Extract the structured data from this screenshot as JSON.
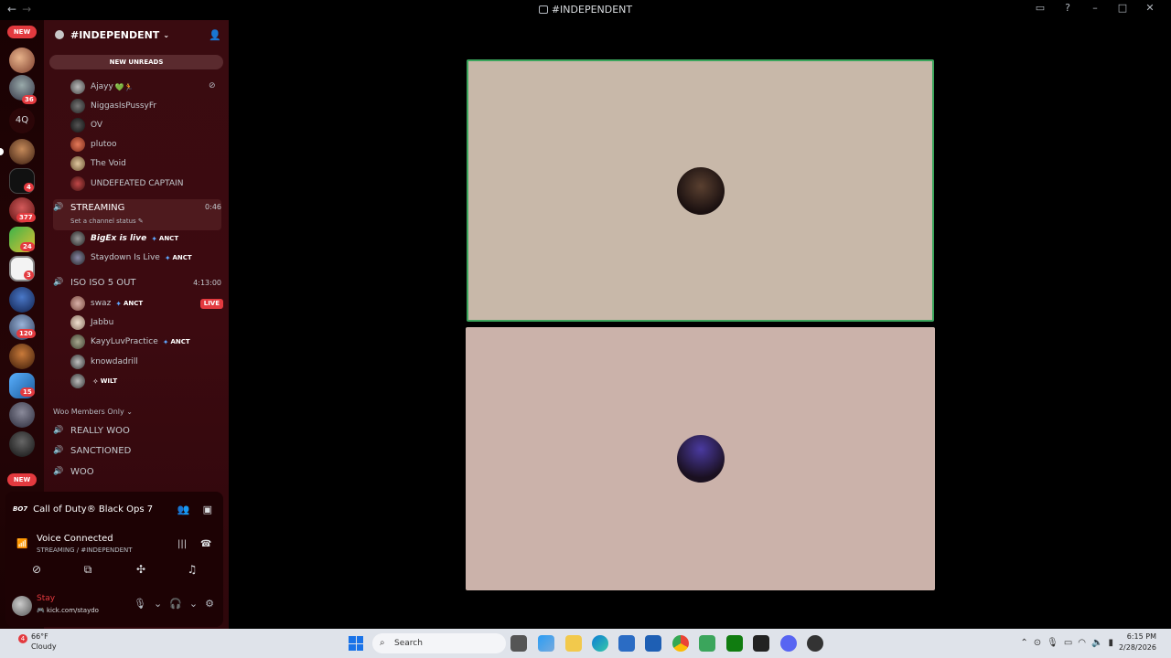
{
  "window": {
    "title": "#INDEPENDENT"
  },
  "server": {
    "name": "#INDEPENDENT",
    "new_unreads": "NEW UNREADS"
  },
  "guild_rail": {
    "new_top": "NEW",
    "badge_36": "36",
    "label_4q": "4Q",
    "badge_4": "4",
    "badge_377": "377",
    "badge_24": "24",
    "badge_3": "3",
    "badge_120": "120",
    "badge_15": "15",
    "new_bottom": "NEW"
  },
  "members_top": [
    {
      "name": "Ajayy",
      "emoji": "💚🏃"
    },
    {
      "name": "NiggasIsPussyFr"
    },
    {
      "name": "OV"
    },
    {
      "name": "plutoo"
    },
    {
      "name": "The Void"
    },
    {
      "name": "UNDEFEATED CAPTAIN"
    }
  ],
  "streaming_channel": {
    "name": "STREAMING",
    "time": "0:46",
    "status_placeholder": "Set a channel status",
    "members": [
      {
        "name": "BigEx is live",
        "tag": "ANCT"
      },
      {
        "name": "Staydown Is Live",
        "tag": "ANCT"
      }
    ]
  },
  "iso_channel": {
    "name": "ISO ISO 5 OUT",
    "time": "4:13:00",
    "live": "LIVE",
    "members": [
      {
        "name": "swaz",
        "tag": "ANCT"
      },
      {
        "name": "Jabbu"
      },
      {
        "name": "KayyLuvPractice",
        "tag": "ANCT"
      },
      {
        "name": "knowdadrill"
      },
      {
        "name": "",
        "tag": "WILT"
      }
    ]
  },
  "category": {
    "name": "Woo Members Only",
    "channels": [
      "REALLY WOO",
      "SANCTIONED",
      "WOO"
    ]
  },
  "game_activity": {
    "logo": "BO7",
    "name": "Call of Duty® Black Ops 7"
  },
  "voice": {
    "status": "Voice Connected",
    "location": "STREAMING / #INDEPENDENT"
  },
  "user": {
    "name": "Stay",
    "status": "kick.com/staydo"
  },
  "taskbar": {
    "temp": "66°F",
    "condition": "Cloudy",
    "weather_badge": "4",
    "search_placeholder": "Search",
    "time": "6:15 PM",
    "date": "2/28/2026"
  },
  "colors": {
    "accent_red": "#e33a3f",
    "speaking_green": "#3ba55c",
    "sidebar_bg": "#3a0b10",
    "tile1_bg": "#c8b8a9",
    "tile2_bg": "#cbb2aa"
  }
}
